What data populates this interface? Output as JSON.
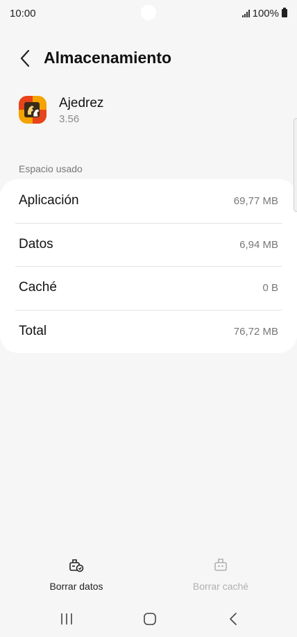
{
  "status_bar": {
    "time": "10:00",
    "battery": "100%",
    "icons": [
      "signal-icon",
      "battery-icon"
    ]
  },
  "header": {
    "title": "Almacenamiento",
    "back_icon": "back-arrow-icon"
  },
  "app": {
    "name": "Ajedrez",
    "version": "3.56",
    "icon": "chess-app-icon",
    "icon_colors": [
      "#f5a300",
      "#e8431a"
    ]
  },
  "storage": {
    "section_label": "Espacio usado",
    "rows": [
      {
        "label": "Aplicación",
        "value": "69,77 MB"
      },
      {
        "label": "Datos",
        "value": "6,94 MB"
      },
      {
        "label": "Caché",
        "value": "0 B"
      },
      {
        "label": "Total",
        "value": "76,72 MB"
      }
    ]
  },
  "actions": {
    "clear_data": {
      "label": "Borrar datos",
      "icon": "clear-data-icon",
      "enabled": true
    },
    "clear_cache": {
      "label": "Borrar caché",
      "icon": "clear-cache-icon",
      "enabled": false
    }
  },
  "navigation": {
    "buttons": [
      "recents-icon",
      "home-icon",
      "back-icon"
    ]
  }
}
